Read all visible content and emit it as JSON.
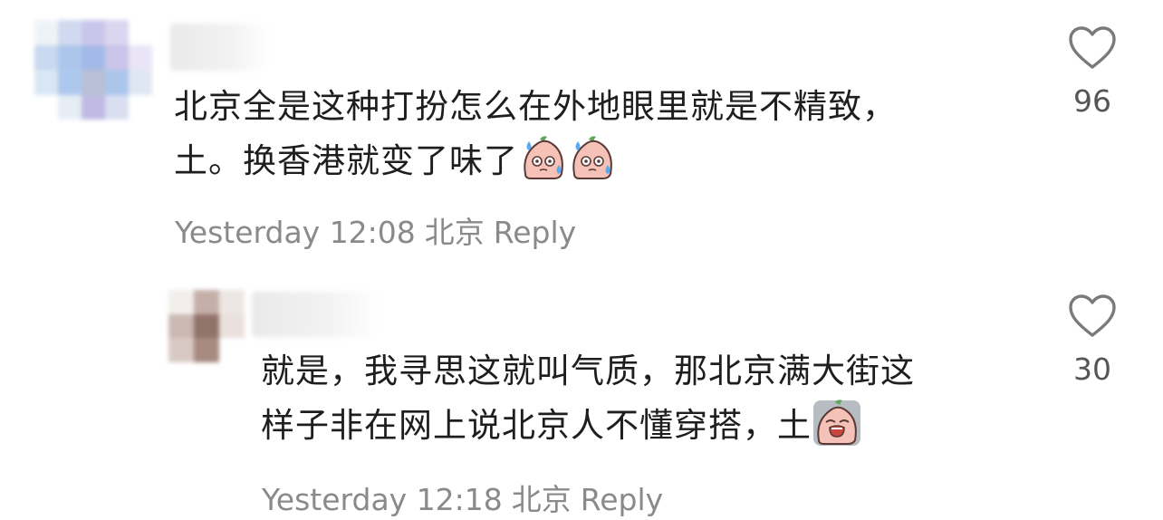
{
  "comments": [
    {
      "lines": [
        "北京全是这种打扮怎么在外地眼里就是不精致，",
        "土。换香港就变了味了"
      ],
      "emoji": [
        "sweat-peach-emoji",
        "sweat-peach-emoji"
      ],
      "time": "Yesterday 12:08",
      "location": "北京",
      "reply_label": "Reply",
      "likes": "96"
    },
    {
      "lines": [
        "就是，我寻思这就叫气质，那北京满大街这",
        "样子非在网上说北京人不懂穿搭，土"
      ],
      "emoji": [
        "crying-peach-emoji"
      ],
      "time": "Yesterday 12:18",
      "location": "北京",
      "reply_label": "Reply",
      "likes": "30"
    }
  ],
  "icons": {
    "like": "heart-outline-icon"
  },
  "colors": {
    "text": "#1e1e1e",
    "meta": "#8a8a8a",
    "count": "#555555",
    "emoji_peach": "#f6c2b8",
    "emoji_sweat": "#5aaaf0"
  }
}
